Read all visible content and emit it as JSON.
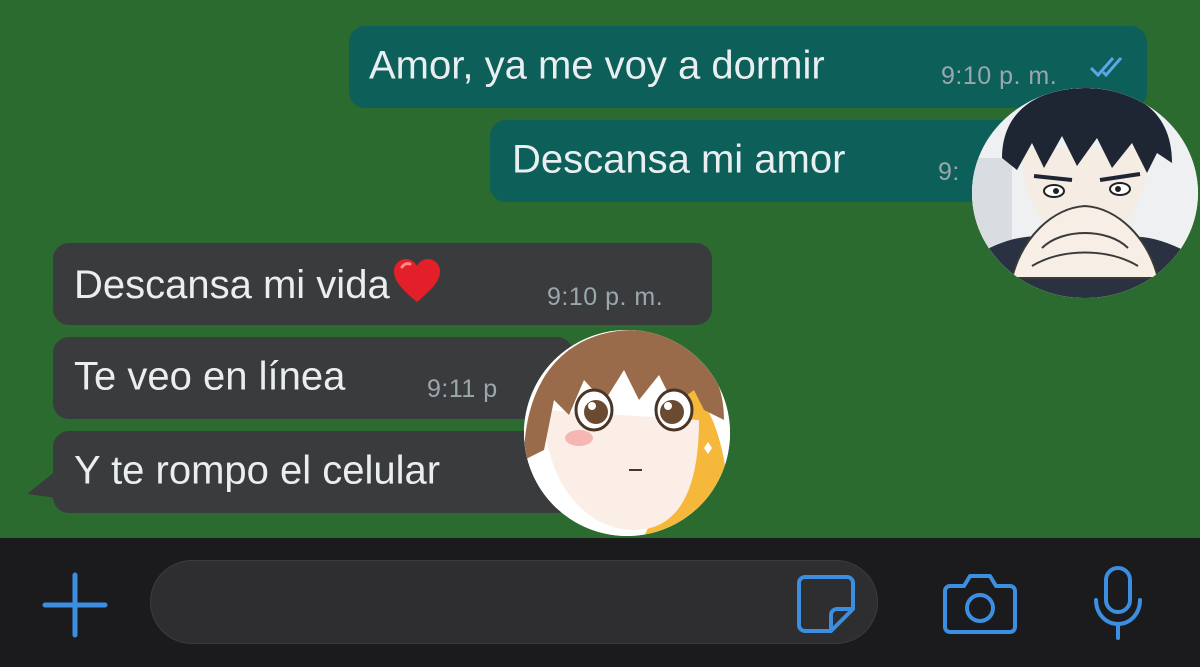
{
  "messages": [
    {
      "id": "msg1",
      "direction": "outgoing",
      "text": "Amor, ya me voy a dormir",
      "time": "9:10 p. m.",
      "status": "read"
    },
    {
      "id": "msg2",
      "direction": "outgoing",
      "text": "Descansa mi amor",
      "time": "9:"
    },
    {
      "id": "msg3",
      "direction": "incoming",
      "text": "Descansa mi vida",
      "emoji": "red-heart-icon",
      "time": "9:10 p. m."
    },
    {
      "id": "msg4",
      "direction": "incoming",
      "text": "Te veo en línea",
      "time": "9:11 p"
    },
    {
      "id": "msg5",
      "direction": "incoming",
      "text": "Y te rompo el celular"
    }
  ],
  "input": {
    "placeholder": "",
    "value": ""
  },
  "icons": {
    "plus": "plus-icon",
    "sticker": "sticker-icon",
    "camera": "camera-icon",
    "mic": "microphone-icon",
    "read_ticks": "double-check-icon"
  },
  "colors": {
    "chat_background": "#2b6b30",
    "outgoing_bubble": "#0d5f5a",
    "incoming_bubble": "#3a3b3d",
    "accent": "#3b8ee0",
    "bar_background": "#1b1b1d"
  }
}
